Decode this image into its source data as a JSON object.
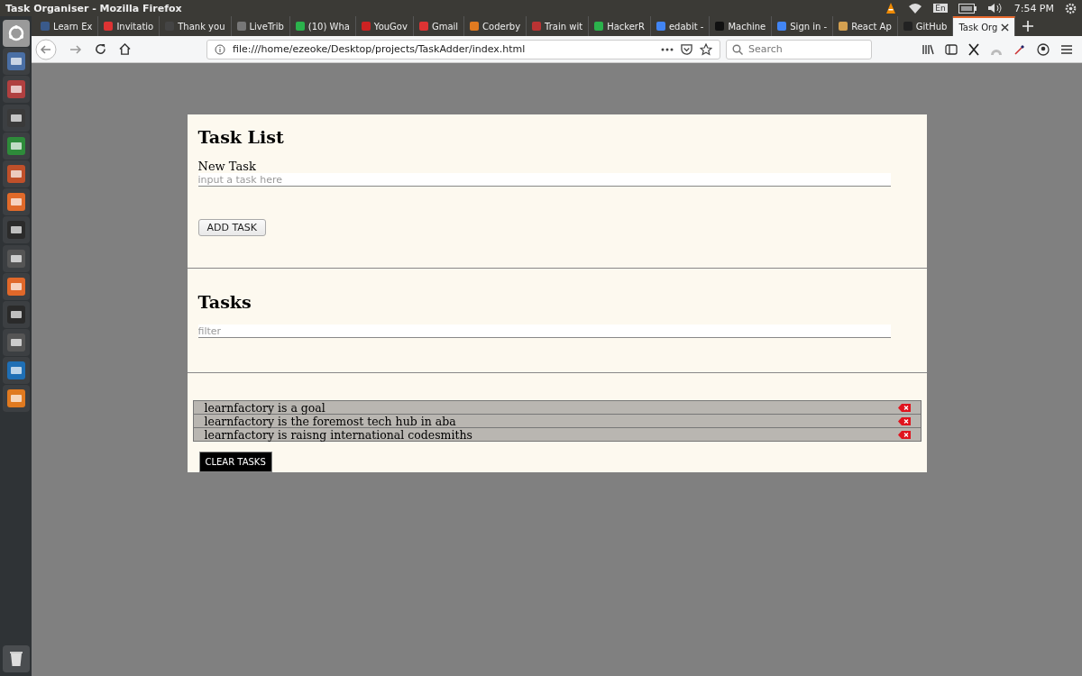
{
  "window": {
    "title": "Task Organiser - Mozilla Firefox"
  },
  "panel": {
    "keyboard": "En",
    "clock": "7:54 PM"
  },
  "tabs": [
    {
      "label": "Learn Ex",
      "selected": false
    },
    {
      "label": "Invitatio",
      "selected": false
    },
    {
      "label": "Thank you",
      "selected": false
    },
    {
      "label": "LiveTrib",
      "selected": false
    },
    {
      "label": "(10) Wha",
      "selected": false
    },
    {
      "label": "YouGov",
      "selected": false
    },
    {
      "label": "Gmail",
      "selected": false
    },
    {
      "label": "Coderby",
      "selected": false
    },
    {
      "label": "Train wit",
      "selected": false
    },
    {
      "label": "HackerR",
      "selected": false
    },
    {
      "label": "edabit -",
      "selected": false
    },
    {
      "label": "Machine",
      "selected": false
    },
    {
      "label": "Sign in -",
      "selected": false
    },
    {
      "label": "React Ap",
      "selected": false
    },
    {
      "label": "GitHub",
      "selected": false
    },
    {
      "label": "Task Org",
      "selected": true
    }
  ],
  "address_bar": {
    "url": "file:///home/ezeoke/Desktop/projects/TaskAdder/index.html"
  },
  "search": {
    "placeholder": "Search"
  },
  "page": {
    "title": "Task List",
    "new_task_label": "New Task",
    "task_placeholder": "input a task here",
    "add_button": "ADD TASK",
    "tasks_heading": "Tasks",
    "filter_placeholder": "filter",
    "tasks": [
      "learnfactory is a goal",
      "learnfactory is the foremost tech hub in aba",
      "learnfactory is raisng international codesmiths"
    ],
    "clear_button": "CLEAR TASKS"
  }
}
